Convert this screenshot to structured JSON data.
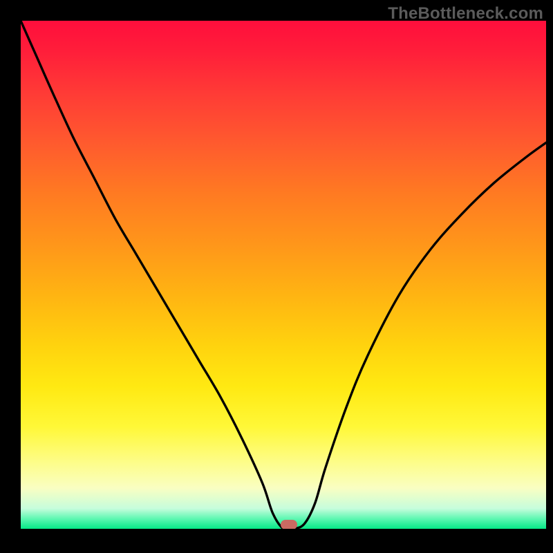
{
  "watermark": "TheBottleneck.com",
  "chart_data": {
    "type": "line",
    "title": "",
    "xlabel": "",
    "ylabel": "",
    "xlim": [
      0,
      100
    ],
    "ylim": [
      0,
      100
    ],
    "grid": false,
    "legend": false,
    "background": {
      "type": "vertical-gradient",
      "stops": [
        {
          "pos": 0,
          "color": "#ff0e3c"
        },
        {
          "pos": 24,
          "color": "#ff5a2e"
        },
        {
          "pos": 54,
          "color": "#ffb412"
        },
        {
          "pos": 80,
          "color": "#fff838"
        },
        {
          "pos": 96,
          "color": "#c6fddc"
        },
        {
          "pos": 100,
          "color": "#05e986"
        }
      ]
    },
    "series": [
      {
        "name": "curve",
        "color": "#000000",
        "x": [
          0,
          3,
          6,
          10,
          14,
          18,
          22,
          26,
          30,
          34,
          38,
          42,
          46,
          48,
          50,
          52,
          54,
          56,
          58,
          62,
          66,
          72,
          78,
          84,
          90,
          96,
          100
        ],
        "y": [
          100,
          93,
          86,
          77,
          69,
          61,
          54,
          47,
          40,
          33,
          26,
          18,
          9,
          3,
          0,
          0,
          1,
          5,
          12,
          24,
          34,
          46,
          55,
          62,
          68,
          73,
          76
        ]
      }
    ],
    "marker": {
      "x": 51,
      "y": 0.8,
      "color": "#c96a62",
      "shape": "pill"
    }
  }
}
